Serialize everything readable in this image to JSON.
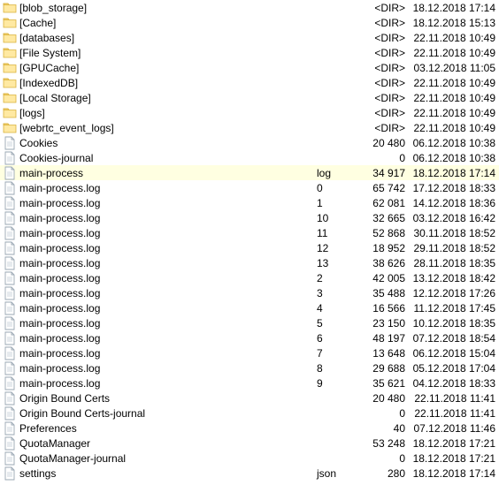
{
  "rows": [
    {
      "icon": "folder",
      "name": "[blob_storage]",
      "ext": "",
      "size": "<DIR>",
      "date": "18.12.2018 17:14",
      "sel": false
    },
    {
      "icon": "folder",
      "name": "[Cache]",
      "ext": "",
      "size": "<DIR>",
      "date": "18.12.2018 15:13",
      "sel": false
    },
    {
      "icon": "folder",
      "name": "[databases]",
      "ext": "",
      "size": "<DIR>",
      "date": "22.11.2018 10:49",
      "sel": false
    },
    {
      "icon": "folder",
      "name": "[File System]",
      "ext": "",
      "size": "<DIR>",
      "date": "22.11.2018 10:49",
      "sel": false
    },
    {
      "icon": "folder",
      "name": "[GPUCache]",
      "ext": "",
      "size": "<DIR>",
      "date": "03.12.2018 11:05",
      "sel": false
    },
    {
      "icon": "folder",
      "name": "[IndexedDB]",
      "ext": "",
      "size": "<DIR>",
      "date": "22.11.2018 10:49",
      "sel": false
    },
    {
      "icon": "folder",
      "name": "[Local Storage]",
      "ext": "",
      "size": "<DIR>",
      "date": "22.11.2018 10:49",
      "sel": false
    },
    {
      "icon": "folder",
      "name": "[logs]",
      "ext": "",
      "size": "<DIR>",
      "date": "22.11.2018 10:49",
      "sel": false
    },
    {
      "icon": "folder",
      "name": "[webrtc_event_logs]",
      "ext": "",
      "size": "<DIR>",
      "date": "22.11.2018 10:49",
      "sel": false
    },
    {
      "icon": "file",
      "name": "Cookies",
      "ext": "",
      "size": "20 480",
      "date": "06.12.2018 10:38",
      "sel": false
    },
    {
      "icon": "file",
      "name": "Cookies-journal",
      "ext": "",
      "size": "0",
      "date": "06.12.2018 10:38",
      "sel": false
    },
    {
      "icon": "file",
      "name": "main-process",
      "ext": "log",
      "size": "34 917",
      "date": "18.12.2018 17:14",
      "sel": true
    },
    {
      "icon": "file",
      "name": "main-process.log",
      "ext": "0",
      "size": "65 742",
      "date": "17.12.2018 18:33",
      "sel": false
    },
    {
      "icon": "file",
      "name": "main-process.log",
      "ext": "1",
      "size": "62 081",
      "date": "14.12.2018 18:36",
      "sel": false
    },
    {
      "icon": "file",
      "name": "main-process.log",
      "ext": "10",
      "size": "32 665",
      "date": "03.12.2018 16:42",
      "sel": false
    },
    {
      "icon": "file",
      "name": "main-process.log",
      "ext": "11",
      "size": "52 868",
      "date": "30.11.2018 18:52",
      "sel": false
    },
    {
      "icon": "file",
      "name": "main-process.log",
      "ext": "12",
      "size": "18 952",
      "date": "29.11.2018 18:52",
      "sel": false
    },
    {
      "icon": "file",
      "name": "main-process.log",
      "ext": "13",
      "size": "38 626",
      "date": "28.11.2018 18:35",
      "sel": false
    },
    {
      "icon": "file",
      "name": "main-process.log",
      "ext": "2",
      "size": "42 005",
      "date": "13.12.2018 18:42",
      "sel": false
    },
    {
      "icon": "file",
      "name": "main-process.log",
      "ext": "3",
      "size": "35 488",
      "date": "12.12.2018 17:26",
      "sel": false
    },
    {
      "icon": "file",
      "name": "main-process.log",
      "ext": "4",
      "size": "16 566",
      "date": "11.12.2018 17:45",
      "sel": false
    },
    {
      "icon": "file",
      "name": "main-process.log",
      "ext": "5",
      "size": "23 150",
      "date": "10.12.2018 18:35",
      "sel": false
    },
    {
      "icon": "file",
      "name": "main-process.log",
      "ext": "6",
      "size": "48 197",
      "date": "07.12.2018 18:54",
      "sel": false
    },
    {
      "icon": "file",
      "name": "main-process.log",
      "ext": "7",
      "size": "13 648",
      "date": "06.12.2018 15:04",
      "sel": false
    },
    {
      "icon": "file",
      "name": "main-process.log",
      "ext": "8",
      "size": "29 688",
      "date": "05.12.2018 17:04",
      "sel": false
    },
    {
      "icon": "file",
      "name": "main-process.log",
      "ext": "9",
      "size": "35 621",
      "date": "04.12.2018 18:33",
      "sel": false
    },
    {
      "icon": "file",
      "name": "Origin Bound Certs",
      "ext": "",
      "size": "20 480",
      "date": "22.11.2018 11:41",
      "sel": false
    },
    {
      "icon": "file",
      "name": "Origin Bound Certs-journal",
      "ext": "",
      "size": "0",
      "date": "22.11.2018 11:41",
      "sel": false
    },
    {
      "icon": "file",
      "name": "Preferences",
      "ext": "",
      "size": "40",
      "date": "07.12.2018 11:46",
      "sel": false
    },
    {
      "icon": "file",
      "name": "QuotaManager",
      "ext": "",
      "size": "53 248",
      "date": "18.12.2018 17:21",
      "sel": false
    },
    {
      "icon": "file",
      "name": "QuotaManager-journal",
      "ext": "",
      "size": "0",
      "date": "18.12.2018 17:21",
      "sel": false
    },
    {
      "icon": "file",
      "name": "settings",
      "ext": "json",
      "size": "280",
      "date": "18.12.2018 17:14",
      "sel": false
    }
  ]
}
